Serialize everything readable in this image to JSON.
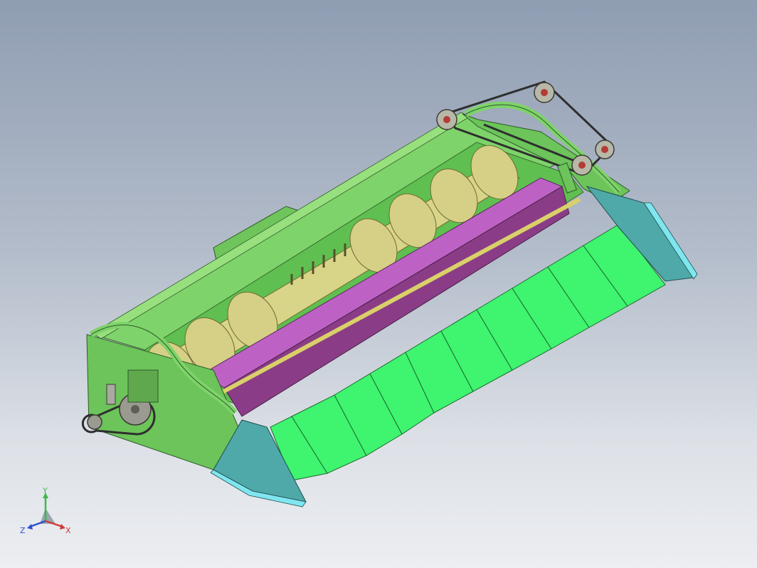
{
  "viewport": {
    "background_top": "#8f9db2",
    "background_bottom": "#eceef1"
  },
  "model": {
    "frame_color": "#7ed36a",
    "trough_color": "#5fbf50",
    "auger_color": "#d8d488",
    "beam_color": "#bd62c4",
    "beam_dark_color": "#8a3d86",
    "divider_color": "#3ff46e",
    "shield_color": "#4fa9a8",
    "shield_light_color": "#7fe6f0",
    "belt_color": "#2e2e2e",
    "pulley_color": "#b8b8a8",
    "pulley_accent_color": "#b33c36",
    "sprocket_color": "#9a9a90",
    "divider_count": 9
  },
  "triad": {
    "y_label": "Y",
    "x_label": "X",
    "z_label": "Z",
    "y_color": "#3fb84a",
    "x_color": "#d23a3a",
    "z_color": "#2d4fd0"
  }
}
